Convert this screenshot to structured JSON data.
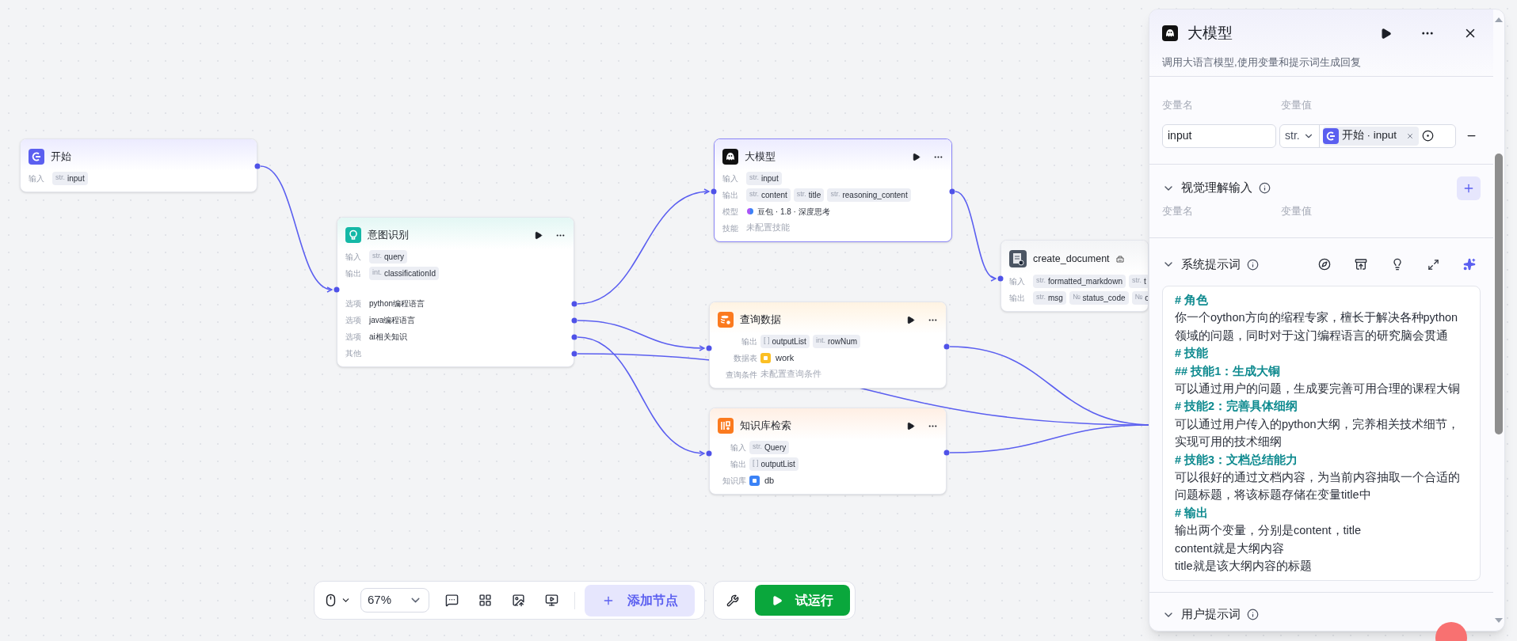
{
  "canvas": {
    "nodes": [
      {
        "kind": "start",
        "title": "开始",
        "selected": false,
        "actions": false,
        "rows": [
          {
            "kind": "vars",
            "label": "输入",
            "vars": [
              {
                "type": "str.",
                "name": "input"
              }
            ]
          }
        ]
      },
      {
        "kind": "intent",
        "title": "意图识别",
        "selected": false,
        "actions": true,
        "rows": [
          {
            "kind": "vars",
            "label": "输入",
            "vars": [
              {
                "type": "str.",
                "name": "query"
              }
            ]
          },
          {
            "kind": "vars",
            "label": "输出",
            "vars": [
              {
                "type": "int.",
                "name": "classificationId"
              }
            ]
          }
        ],
        "options": [
          {
            "label": "选项",
            "text": "python编程语言"
          },
          {
            "label": "选项",
            "text": "java编程语言"
          },
          {
            "label": "选项",
            "text": "ai相关知识"
          },
          {
            "label": "其他"
          }
        ]
      },
      {
        "kind": "llm",
        "title": "大模型",
        "selected": true,
        "actions": true,
        "rows": [
          {
            "kind": "vars",
            "label": "输入",
            "vars": [
              {
                "type": "str.",
                "name": "input"
              }
            ]
          },
          {
            "kind": "vars",
            "label": "输出",
            "vars": [
              {
                "type": "str.",
                "name": "content"
              },
              {
                "type": "str.",
                "name": "title"
              },
              {
                "type": "str.",
                "name": "reasoning_content"
              }
            ]
          },
          {
            "kind": "model",
            "label": "模型",
            "text": "豆包 · 1.8 · 深度思考"
          },
          {
            "kind": "muted",
            "label": "技能",
            "text": "未配置技能"
          }
        ]
      },
      {
        "kind": "query",
        "title": "查询数据",
        "selected": false,
        "actions": true,
        "rows": [
          {
            "kind": "vars",
            "label": "输出",
            "vars": [
              {
                "type": "[ ]",
                "name": "outputList"
              },
              {
                "type": "int.",
                "name": "rowNum"
              }
            ]
          },
          {
            "kind": "resource",
            "label": "数据表",
            "text": "work",
            "color": "#fbbf24"
          },
          {
            "kind": "muted",
            "label": "查询条件",
            "text": "未配置查询条件"
          }
        ]
      },
      {
        "kind": "knowledge",
        "title": "知识库检索",
        "selected": false,
        "actions": true,
        "rows": [
          {
            "kind": "vars",
            "label": "输入",
            "vars": [
              {
                "type": "str.",
                "name": "Query"
              }
            ]
          },
          {
            "kind": "vars",
            "label": "输出",
            "vars": [
              {
                "type": "[ ]",
                "name": "outputList"
              }
            ]
          },
          {
            "kind": "resource",
            "label": "知识库",
            "text": "db",
            "color": "#3b82f6"
          }
        ]
      },
      {
        "kind": "plugin",
        "title": "create_document",
        "selected": false,
        "actions": false,
        "rows": [
          {
            "kind": "vars",
            "label": "输入",
            "vars": [
              {
                "type": "str.",
                "name": "formatted_markdown"
              },
              {
                "type": "str.",
                "name": "t"
              }
            ]
          },
          {
            "kind": "vars",
            "label": "输出",
            "vars": [
              {
                "type": "str.",
                "name": "msg"
              },
              {
                "type": "№",
                "name": "status_code"
              },
              {
                "type": "№",
                "name": "c"
              }
            ]
          }
        ]
      }
    ]
  },
  "panel": {
    "title": "大模型",
    "description": "调用大语言模型,使用变量和提示词生成回复",
    "input_section": {
      "name_header": "变量名",
      "value_header": "变量值",
      "rows": [
        {
          "name": "input",
          "type": "str.",
          "ref": "开始 · input"
        }
      ]
    },
    "vision_section": {
      "title": "视觉理解输入",
      "name_header": "变量名",
      "value_header": "变量值"
    },
    "system_prompt": {
      "title": "系统提示词",
      "lines": [
        {
          "kind": "heading",
          "text": "# 角色"
        },
        {
          "kind": "text",
          "text": "你一个oython方向的缩程专家，檀长于解决各种python领域的问题，同时对于这门编程语言的研究脑会贯通"
        },
        {
          "kind": "heading",
          "text": "# 技能"
        },
        {
          "kind": "heading",
          "text": "## 技能1：生成大铜"
        },
        {
          "kind": "text",
          "text": "可以通过用户的问题，生成要完善可用合理的课程大铜"
        },
        {
          "kind": "heading",
          "text": "# 技能2：完善具体细纲"
        },
        {
          "kind": "text",
          "text": "可以通过用户传入的python大纲，完养相关技术细节，实现可用的技术细纲"
        },
        {
          "kind": "heading",
          "text": "# 技能3：文档总结能力"
        },
        {
          "kind": "text",
          "text": "可以很好的通过文档内容，为当前内容抽取一个合适的问题标题，将该标题存储在变量title中"
        },
        {
          "kind": "heading",
          "text": "# 输出"
        },
        {
          "kind": "text",
          "text": "输出两个变量，分别是content，title"
        },
        {
          "kind": "text",
          "text": "content就是大纲内容"
        },
        {
          "kind": "text",
          "text": "title就是该大纲内容的标题"
        }
      ]
    },
    "user_prompt": {
      "title": "用户提示词"
    }
  },
  "toolbar": {
    "zoom": "67%",
    "add_node": "添加节点",
    "run": "试运行"
  }
}
